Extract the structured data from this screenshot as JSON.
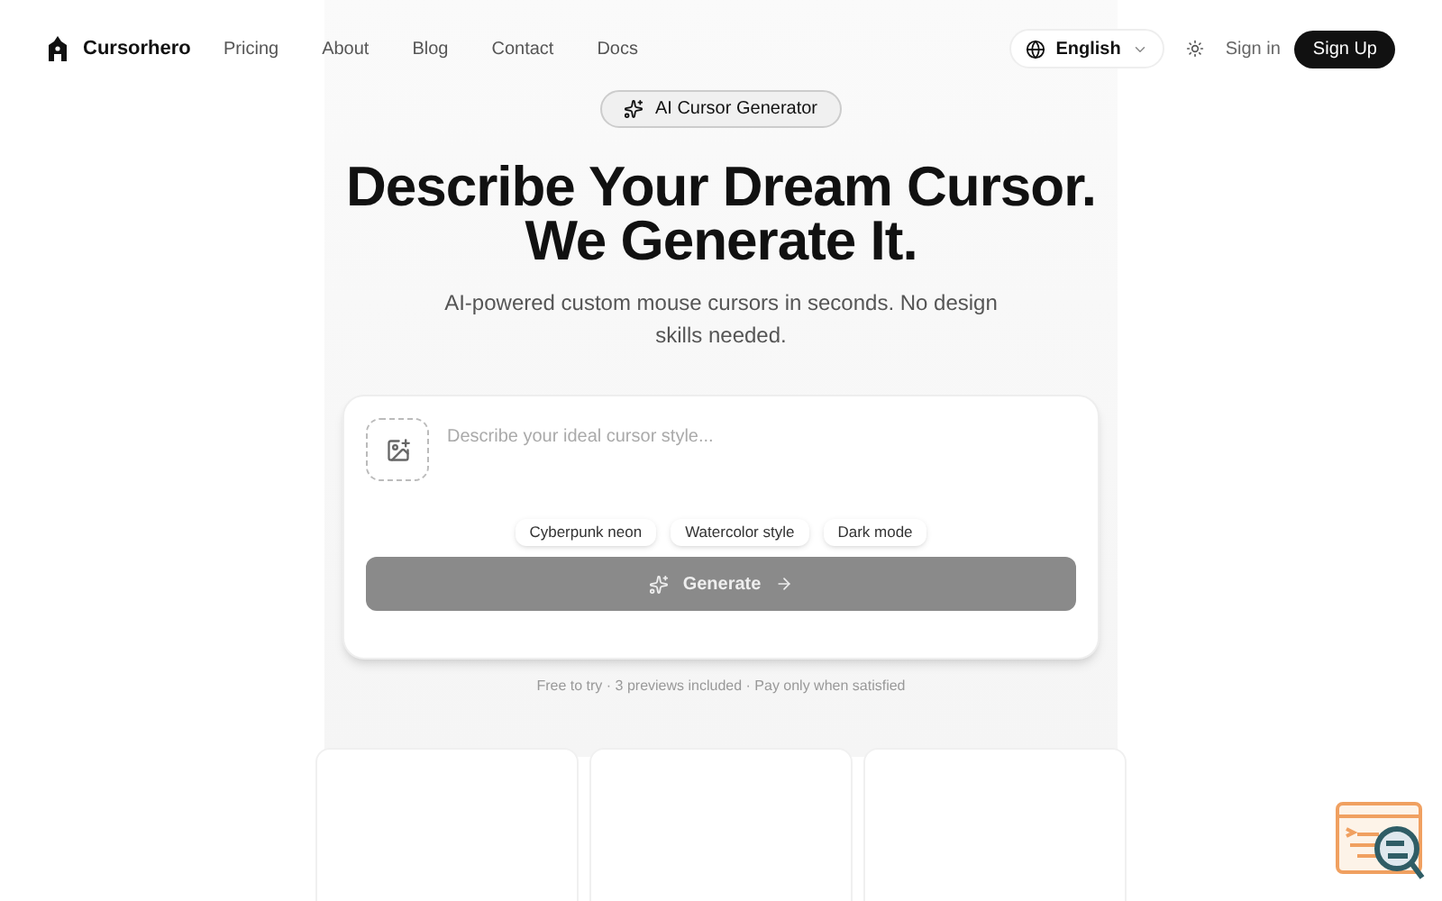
{
  "brand": {
    "name": "Cursorhero"
  },
  "nav": [
    {
      "label": "Pricing"
    },
    {
      "label": "About"
    },
    {
      "label": "Blog"
    },
    {
      "label": "Contact"
    },
    {
      "label": "Docs"
    }
  ],
  "language": {
    "label": "English"
  },
  "auth": {
    "sign_in": "Sign in",
    "sign_up": "Sign Up"
  },
  "hero": {
    "badge": "AI Cursor Generator",
    "title_lines": [
      "Describe Your Dream Cursor.",
      "We Generate It."
    ],
    "subtitle": "AI-powered custom mouse cursors in seconds. No design skills needed."
  },
  "prompt": {
    "placeholder": "Describe your ideal cursor style...",
    "suggestions": [
      "Cyberpunk neon",
      "Watercolor style",
      "Dark mode"
    ],
    "generate": {
      "label": "Generate",
      "disabled": true
    }
  },
  "note": "Free to try · 3 previews included · Pay only when satisfied",
  "preview_cards": [
    {
      "kind": "blank"
    },
    {
      "kind": "blank"
    },
    {
      "kind": "blank"
    }
  ]
}
